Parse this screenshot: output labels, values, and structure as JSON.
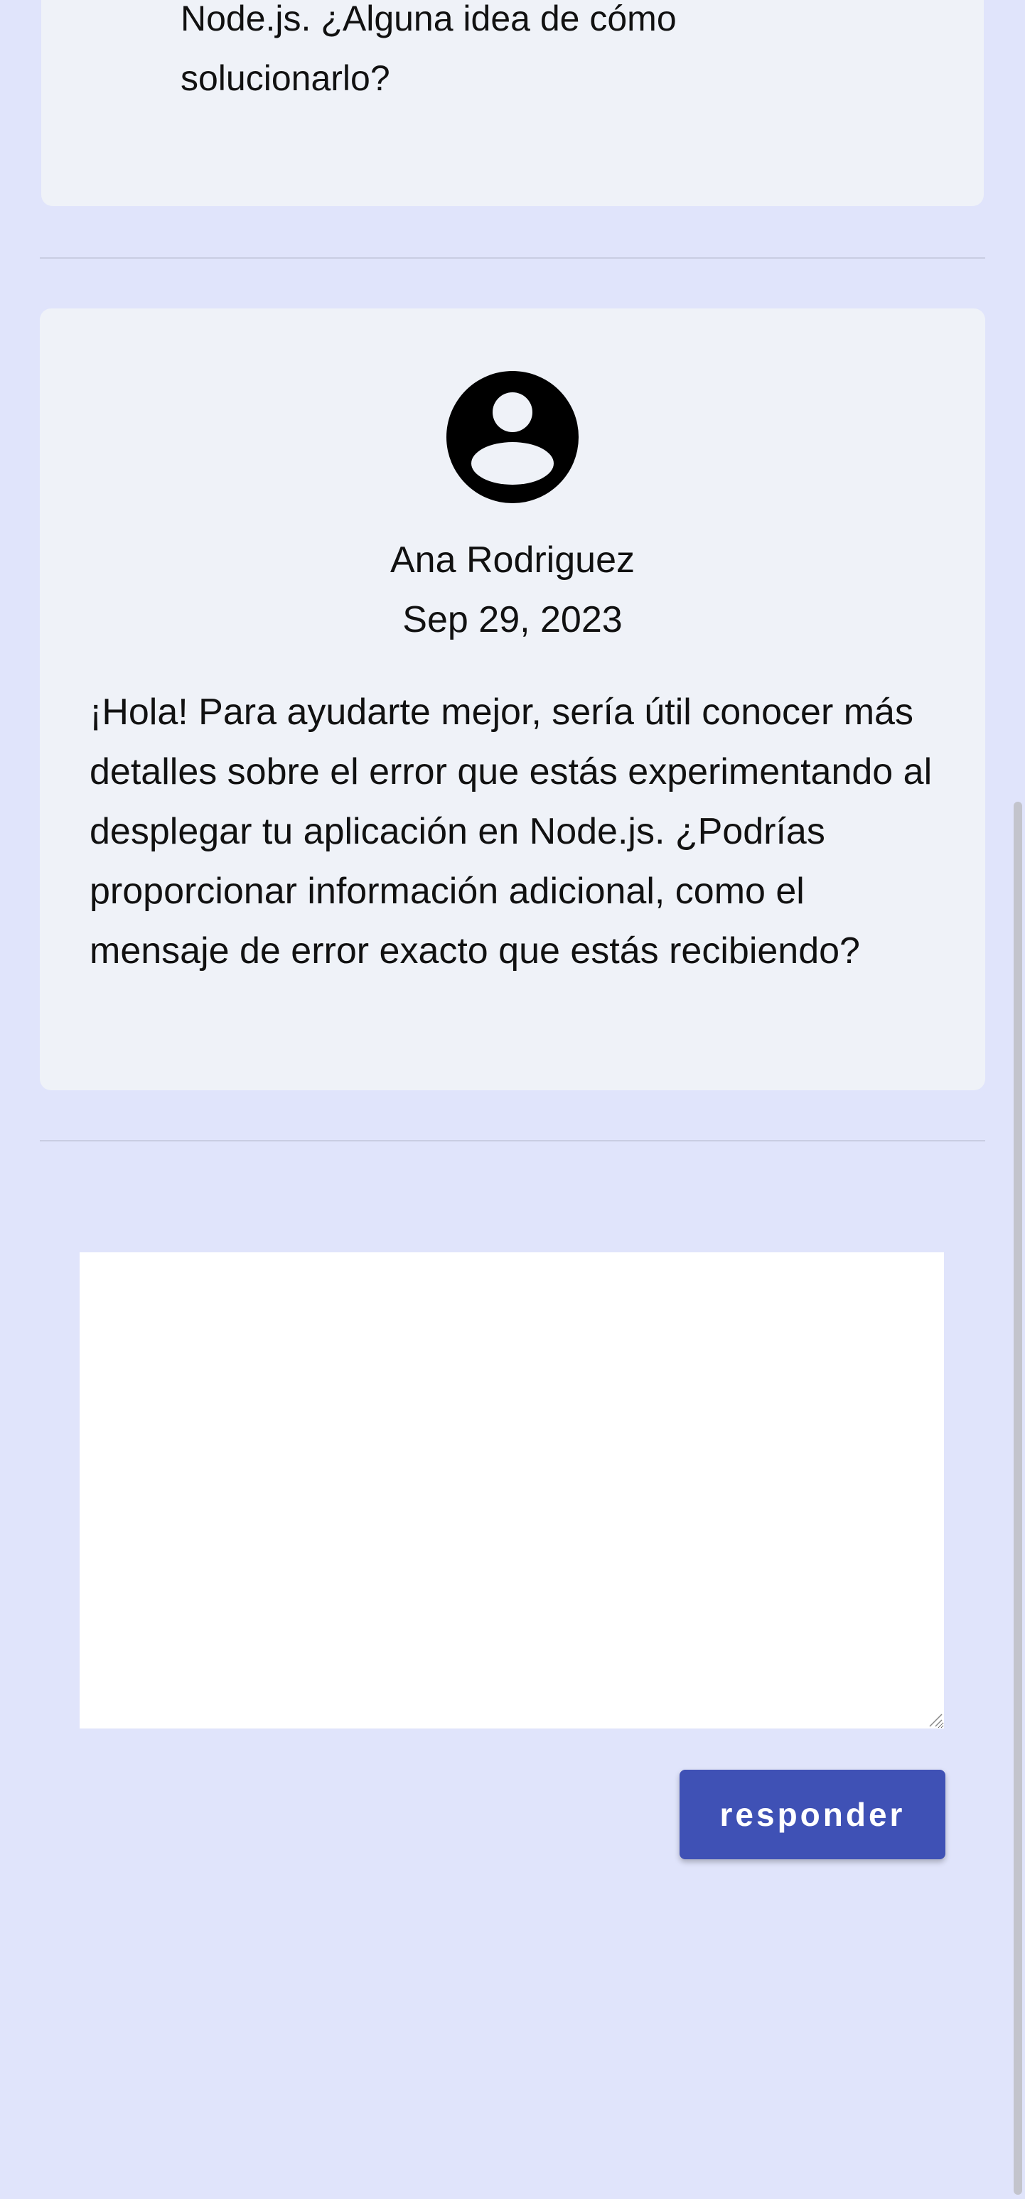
{
  "previous_post": {
    "text_line1": "Node.js. ¿Alguna idea de cómo",
    "text_line2": "solucionarlo?"
  },
  "reply_post": {
    "author": "Ana Rodriguez",
    "date": "Sep 29, 2023",
    "body": "¡Hola! Para ayudarte mejor, sería útil conocer más detalles sobre el error que estás experimentando al desplegar tu aplicación en Node.js. ¿Podrías proporcionar información adicional, como el mensaje de error exacto que estás recibiendo?",
    "avatar_icon": "account-circle-icon"
  },
  "reply_form": {
    "value": "",
    "button_label": "responder"
  },
  "colors": {
    "page_background": "#e0e4fb",
    "card_background": "#eff2f8",
    "button": "#3f51b5"
  }
}
